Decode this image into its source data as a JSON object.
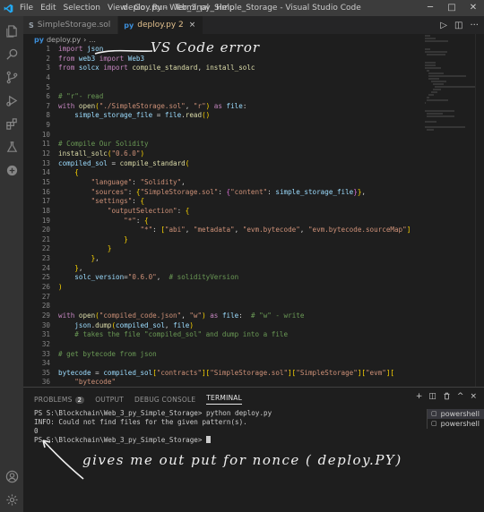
{
  "titlebar": {
    "menus": [
      "File",
      "Edit",
      "Selection",
      "View",
      "Go",
      "Run",
      "Terminal",
      "Help"
    ],
    "title": "deploy.py - Web_3_py_Simple_Storage - Visual Studio Code",
    "min": "─",
    "max": "□",
    "close": "✕"
  },
  "tabs": [
    {
      "label": "SimpleStorage.sol",
      "icon": "S",
      "active": false
    },
    {
      "label": "deploy.py 2",
      "icon": "py",
      "active": true
    }
  ],
  "tab_close": "×",
  "editor_actions": {
    "run": "▷",
    "split": "◫",
    "more": "···"
  },
  "breadcrumb": {
    "icon": "py",
    "file": "deploy.py",
    "sep": "›",
    "more": "..."
  },
  "code_lines": [
    {
      "n": "1",
      "t": "import json"
    },
    {
      "n": "2",
      "t": "from web3 import Web3"
    },
    {
      "n": "3",
      "t": "from solcx import compile_standard, install_solc"
    },
    {
      "n": "4",
      "t": ""
    },
    {
      "n": "5",
      "t": ""
    },
    {
      "n": "6",
      "t": "# \"r\"- read"
    },
    {
      "n": "7",
      "t": "with open(\"./SimpleStorage.sol\", \"r\") as file:"
    },
    {
      "n": "8",
      "t": "    simple_storage_file = file.read()"
    },
    {
      "n": "9",
      "t": ""
    },
    {
      "n": "10",
      "t": ""
    },
    {
      "n": "11",
      "t": "# Compile Our Solidity"
    },
    {
      "n": "12",
      "t": "install_solc(\"0.6.0\")"
    },
    {
      "n": "13",
      "t": "compiled_sol = compile_standard("
    },
    {
      "n": "14",
      "t": "    {"
    },
    {
      "n": "15",
      "t": "        \"language\": \"Solidity\","
    },
    {
      "n": "16",
      "t": "        \"sources\": {\"SimpleStorage.sol\": {\"content\": simple_storage_file}},"
    },
    {
      "n": "17",
      "t": "        \"settings\": {"
    },
    {
      "n": "18",
      "t": "            \"outputSelection\": {"
    },
    {
      "n": "19",
      "t": "                \"*\": {"
    },
    {
      "n": "20",
      "t": "                    \"*\": [\"abi\", \"metadata\", \"evm.bytecode\", \"evm.bytecode.sourceMap\"]"
    },
    {
      "n": "21",
      "t": "                }"
    },
    {
      "n": "22",
      "t": "            }"
    },
    {
      "n": "23",
      "t": "        },"
    },
    {
      "n": "24",
      "t": "    },"
    },
    {
      "n": "25",
      "t": "    solc_version=\"0.6.0\",  # solidityVersion"
    },
    {
      "n": "26",
      "t": ")"
    },
    {
      "n": "27",
      "t": ""
    },
    {
      "n": "28",
      "t": ""
    },
    {
      "n": "29",
      "t": "with open(\"compiled_code.json\", \"w\") as file:  # \"w\" - write"
    },
    {
      "n": "30",
      "t": "    json.dump(compiled_sol, file)"
    },
    {
      "n": "31",
      "t": "    # takes the file \"compiled_sol\" and dump into a file"
    },
    {
      "n": "32",
      "t": ""
    },
    {
      "n": "33",
      "t": "# get bytecode from json"
    },
    {
      "n": "34",
      "t": ""
    },
    {
      "n": "35",
      "t": "bytecode = compiled_sol[\"contracts\"][\"SimpleStorage.sol\"][\"SimpleStorage\"][\"evm\"]["
    },
    {
      "n": "36",
      "t": "    \"bytecode\""
    }
  ],
  "panel": {
    "tabs": [
      "PROBLEMS",
      "OUTPUT",
      "DEBUG CONSOLE",
      "TERMINAL"
    ],
    "problems_badge": "2",
    "actions": {
      "add": "+",
      "split": "◫",
      "trash": "🗑",
      "maximize": "^",
      "close": "×"
    },
    "terminal_lines": [
      "PS S:\\Blockchain\\Web_3_py_Simple_Storage> python deploy.py",
      "INFO: Could not find files for the given pattern(s).",
      "0",
      "PS S:\\Blockchain\\Web_3_py_Simple_Storage> "
    ],
    "terminals": [
      "powershell",
      "powershell"
    ],
    "terminal_glyph": "▢"
  },
  "annotations": {
    "top": "VS Code error",
    "bottom": "gives me out put for nonce ( deploy.PY)"
  },
  "colors": {
    "accent": "#007acc",
    "keyword": "#c586c0",
    "string": "#ce9178",
    "function": "#dcdcaa",
    "comment": "#6a9955"
  }
}
